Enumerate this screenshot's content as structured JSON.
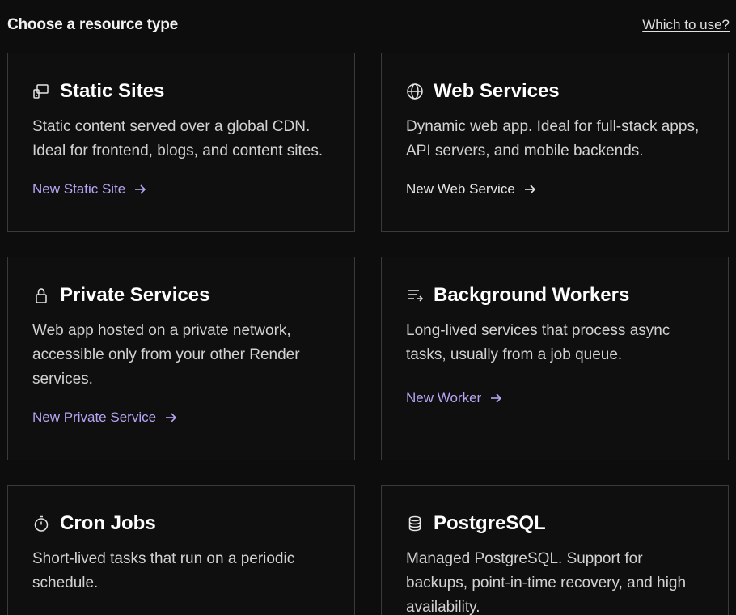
{
  "header": {
    "title": "Choose a resource type",
    "help_link": "Which to use?"
  },
  "cards": [
    {
      "title": "Static Sites",
      "icon": "static-site-icon",
      "description": "Static content served over a global CDN. Ideal for frontend, blogs, and content sites.",
      "link": "New Static Site",
      "link_color": "#b9a5f5"
    },
    {
      "title": "Web Services",
      "icon": "globe-icon",
      "description": "Dynamic web app. Ideal for full-stack apps, API servers, and mobile backends.",
      "link": "New Web Service",
      "link_color": "#e6e6e6"
    },
    {
      "title": "Private Services",
      "icon": "lock-icon",
      "description": "Web app hosted on a private network, accessible only from your other Render services.",
      "link": "New Private Service",
      "link_color": "#b9a5f5"
    },
    {
      "title": "Background Workers",
      "icon": "list-arrow-icon",
      "description": "Long-lived services that process async tasks, usually from a job queue.",
      "link": "New Worker",
      "link_color": "#b9a5f5"
    },
    {
      "title": "Cron Jobs",
      "icon": "stopwatch-icon",
      "description": "Short-lived tasks that run on a periodic schedule."
    },
    {
      "title": "PostgreSQL",
      "icon": "database-icon",
      "description": "Managed PostgreSQL. Support for backups, point-in-time recovery, and high availability."
    }
  ]
}
